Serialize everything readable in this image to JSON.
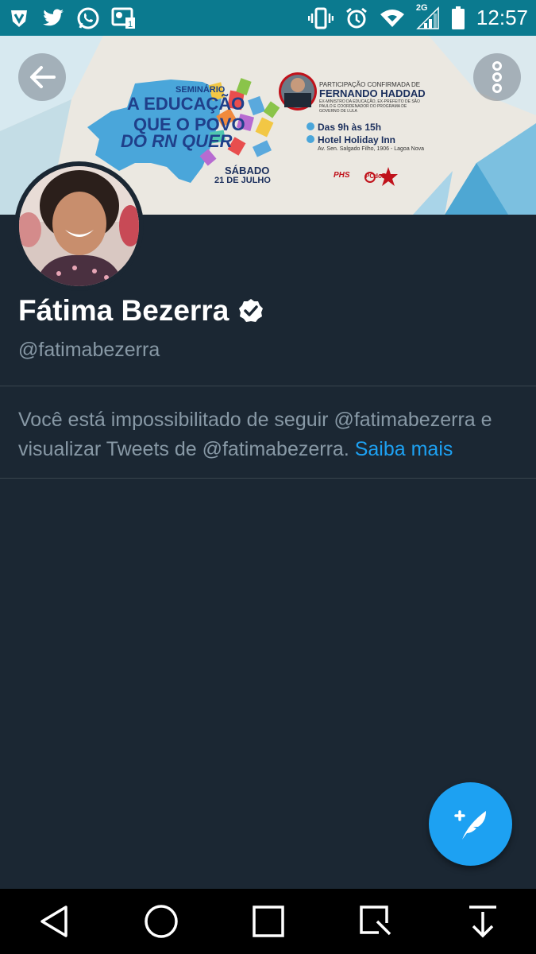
{
  "status_bar": {
    "time": "12:57",
    "network": "2G",
    "left_icons": [
      "shield-icon",
      "twitter-icon",
      "whatsapp-icon",
      "notification-icon"
    ],
    "right_icons": [
      "vibrate-icon",
      "alarm-icon",
      "wifi-icon",
      "signal-icon",
      "battery-icon"
    ],
    "color": "#0b7a8f"
  },
  "banner": {
    "seminar_label": "SEMINÁRIO",
    "title_lines": [
      "A EDUCAÇÃO",
      "QUE O POVO",
      "DO RN QUER"
    ],
    "date_weekday": "SÁBADO",
    "date": "21 DE JULHO",
    "participation_label": "PARTICIPAÇÃO CONFIRMADA DE",
    "participant": "FERNANDO HADDAD",
    "participant_desc": "EX-MINISTRO DA EDUCAÇÃO, EX-PREFEITO DE SÃO PAULO E COORDENADOR DO PROGRAMA DE GOVERNO DE LULA",
    "time": "Das 9h às 15h",
    "place": "Hotel Holiday Inn",
    "address": "Av. Sen. Salgado Filho, 1906 - Lagoa Nova",
    "parties": [
      "PHS",
      "PCdoB"
    ]
  },
  "profile": {
    "name": "Fátima Bezerra",
    "handle": "@fatimabezerra",
    "verified": true
  },
  "message": {
    "text": "Você está impossibilitado de seguir @fatimabezerra e visualizar Tweets de @fatimabezerra.",
    "link": "Saiba mais"
  },
  "colors": {
    "background": "#1b2733",
    "accent": "#1da1f2",
    "secondary_text": "#8899a6"
  }
}
